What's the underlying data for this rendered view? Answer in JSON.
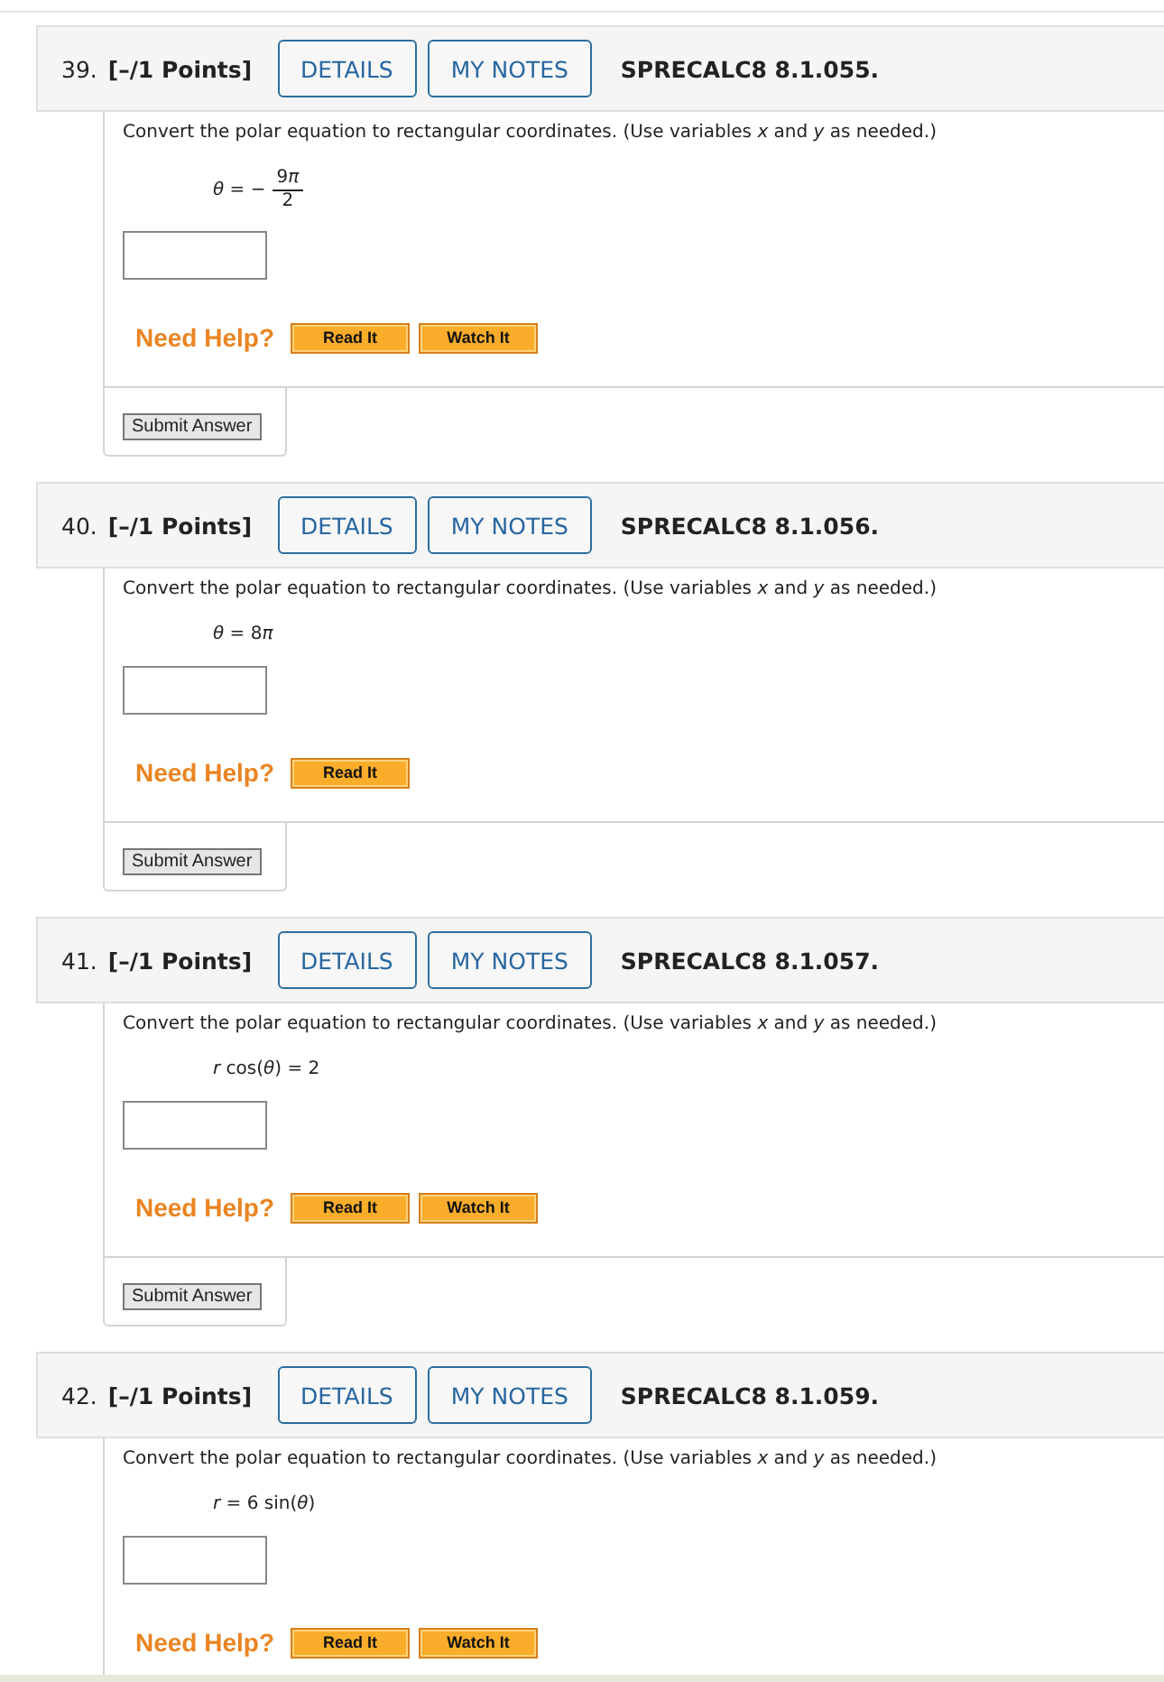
{
  "problems": [
    {
      "number": "39.",
      "points": "[–/1 Points]",
      "buttons": [
        "DETAILS",
        "MY NOTES"
      ],
      "code": "SPRECALC8 8.1.055.",
      "prompt": "Convert the polar equation to rectangular coordinates. (Use variables *x* and *y* as needed.)",
      "equation": {
        "kind": "fraction",
        "lhs": [
          {
            "text": "θ",
            "italic": true
          },
          {
            "text": " = −"
          }
        ],
        "numerator": [
          {
            "text": "9"
          },
          {
            "text": "π",
            "italic": true
          }
        ],
        "denominator": [
          {
            "text": "2"
          }
        ]
      },
      "help_label": "Need Help?",
      "help_buttons": [
        "Read It",
        "Watch It"
      ],
      "submit": "Submit Answer"
    },
    {
      "number": "40.",
      "points": "[–/1 Points]",
      "buttons": [
        "DETAILS",
        "MY NOTES"
      ],
      "code": "SPRECALC8 8.1.056.",
      "prompt": "Convert the polar equation to rectangular coordinates. (Use variables *x* and *y* as needed.)",
      "equation": {
        "kind": "plain",
        "parts": [
          {
            "text": "θ",
            "italic": true
          },
          {
            "text": " = 8"
          },
          {
            "text": "π",
            "italic": true
          }
        ]
      },
      "help_label": "Need Help?",
      "help_buttons": [
        "Read It"
      ],
      "submit": "Submit Answer"
    },
    {
      "number": "41.",
      "points": "[–/1 Points]",
      "buttons": [
        "DETAILS",
        "MY NOTES"
      ],
      "code": "SPRECALC8 8.1.057.",
      "prompt": "Convert the polar equation to rectangular coordinates. (Use variables *x* and *y* as needed.)",
      "equation": {
        "kind": "plain",
        "parts": [
          {
            "text": "r",
            "italic": true
          },
          {
            "text": " cos("
          },
          {
            "text": "θ",
            "italic": true
          },
          {
            "text": ") = 2"
          }
        ]
      },
      "help_label": "Need Help?",
      "help_buttons": [
        "Read It",
        "Watch It"
      ],
      "submit": "Submit Answer"
    },
    {
      "number": "42.",
      "points": "[–/1 Points]",
      "buttons": [
        "DETAILS",
        "MY NOTES"
      ],
      "code": "SPRECALC8 8.1.059.",
      "prompt": "Convert the polar equation to rectangular coordinates. (Use variables *x* and *y* as needed.)",
      "equation": {
        "kind": "plain",
        "parts": [
          {
            "text": "r",
            "italic": true
          },
          {
            "text": " = 6 sin("
          },
          {
            "text": "θ",
            "italic": true
          },
          {
            "text": ")"
          }
        ]
      },
      "help_label": "Need Help?",
      "help_buttons": [
        "Read It",
        "Watch It"
      ]
    }
  ]
}
